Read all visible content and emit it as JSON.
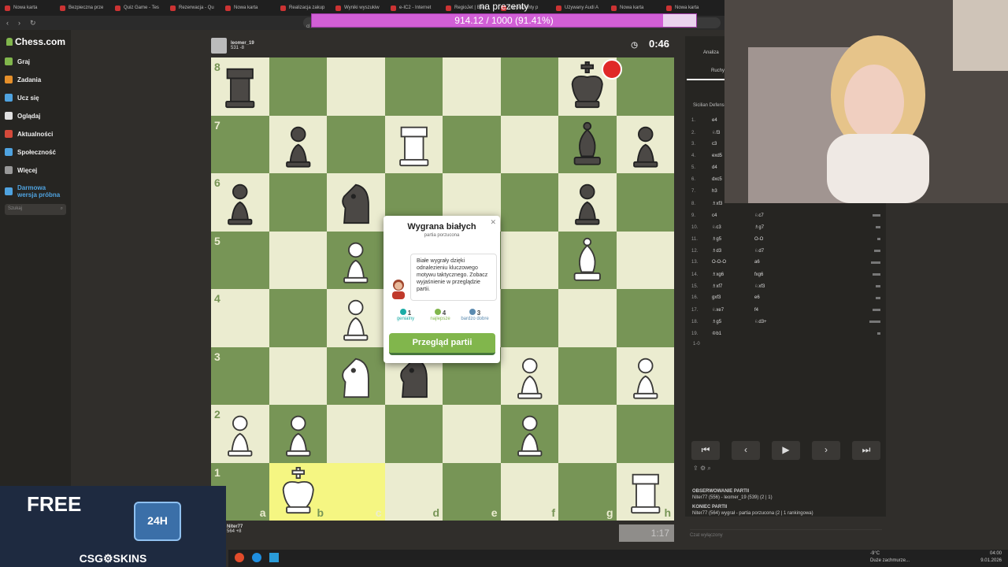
{
  "browser": {
    "tabs": [
      "Nowa karta",
      "Bezpieczna prze",
      "Quiz Game - Tes",
      "Rezerwacja - Qu",
      "Nowa karta",
      "Realizacja zakup",
      "Wyniki wyszukiw",
      "e-IC2 - Internet",
      "RegioJet | Bilet",
      "na prezenty p",
      "Używany Audi A",
      "Nowa karta",
      "Nowa karta"
    ],
    "address_stub": "cl"
  },
  "stream_overlay": {
    "title": "na prezenty",
    "progress_text": "914.12 / 1000 (91.41%)",
    "progress_fraction": 0.9141
  },
  "sidebar": {
    "logo": "Chess.com",
    "items": [
      {
        "label": "Graj",
        "color": "#81b64c"
      },
      {
        "label": "Zadania",
        "color": "#e58f2a"
      },
      {
        "label": "Ucz się",
        "color": "#4fa3e0"
      },
      {
        "label": "Oglądaj",
        "color": "#e0e0e0"
      },
      {
        "label": "Aktualności",
        "color": "#d4493a"
      },
      {
        "label": "Społeczność",
        "color": "#4fa3e0"
      },
      {
        "label": "Więcej",
        "color": "#999999"
      },
      {
        "label": "Darmowa wersja próbna",
        "color": "#4fa3e0"
      }
    ],
    "search_placeholder": "Szukaj"
  },
  "top_player": {
    "name": "leomer_19",
    "rating": "531 -8",
    "clock": "0:46"
  },
  "bottom_player": {
    "name": "Niter77",
    "rating": "564 +8",
    "clock": "1:17"
  },
  "board": {
    "ranks": [
      "8",
      "7",
      "6",
      "5",
      "4",
      "3",
      "2",
      "1"
    ],
    "files": [
      "a",
      "b",
      "c",
      "d",
      "e",
      "f",
      "g",
      "h"
    ],
    "pieces": [
      [
        "br",
        "",
        "",
        "",
        "",
        "",
        "bk",
        ""
      ],
      [
        "",
        "bp",
        "",
        "wr",
        "",
        "",
        "bb",
        "bp"
      ],
      [
        "bp",
        "",
        "bn",
        "",
        "",
        "",
        "bp",
        ""
      ],
      [
        "",
        "",
        "wp",
        "",
        "",
        "",
        "wb",
        ""
      ],
      [
        "",
        "",
        "wp",
        "",
        "",
        "",
        "",
        ""
      ],
      [
        "",
        "",
        "wn",
        "bn",
        "",
        "wp",
        "",
        "wp"
      ],
      [
        "wp",
        "wp",
        "",
        "",
        "",
        "wp",
        "",
        ""
      ],
      [
        "",
        "wk",
        "",
        "",
        "",
        "",
        "",
        "wr"
      ]
    ]
  },
  "modal": {
    "title": "Wygrana białych",
    "subtitle": "partia porzucona",
    "message": "Białe wygrały dzięki odnalezieniu kluczowego motywu taktycznego. Zobacz wyjaśnienie w przeglądzie partii.",
    "stats": [
      {
        "n": "1",
        "label": "genialny",
        "color": "#1baca6"
      },
      {
        "n": "4",
        "label": "najlepsze",
        "color": "#81b64c"
      },
      {
        "n": "3",
        "label": "bardzo dobre",
        "color": "#5c8bb0"
      }
    ],
    "button": "Przegląd partii"
  },
  "panel": {
    "tabs": [
      "Analiza",
      "Ruchy"
    ],
    "opening": "Sicilian Defense",
    "moves": [
      {
        "n": "1.",
        "w": "e4",
        "b": ""
      },
      {
        "n": "2.",
        "w": "♘f3",
        "b": ""
      },
      {
        "n": "3.",
        "w": "c3",
        "b": ""
      },
      {
        "n": "4.",
        "w": "exd5",
        "b": ""
      },
      {
        "n": "5.",
        "w": "d4",
        "b": ""
      },
      {
        "n": "6.",
        "w": "dxc5",
        "b": ""
      },
      {
        "n": "7.",
        "w": "h3",
        "b": ""
      },
      {
        "n": "8.",
        "w": "♗xf3",
        "b": ""
      },
      {
        "n": "9.",
        "w": "c4",
        "b": "♘c7"
      },
      {
        "n": "10.",
        "w": "♘c3",
        "b": "♗g7"
      },
      {
        "n": "11.",
        "w": "♗g5",
        "b": "O-O"
      },
      {
        "n": "12.",
        "w": "♗d3",
        "b": "♘d7"
      },
      {
        "n": "13.",
        "w": "O-O-O",
        "b": "a6"
      },
      {
        "n": "14.",
        "w": "♗xg6",
        "b": "fxg6"
      },
      {
        "n": "15.",
        "w": "♗xf7",
        "b": "♘xf3"
      },
      {
        "n": "16.",
        "w": "gxf3",
        "b": "e6"
      },
      {
        "n": "17.",
        "w": "♘xe7",
        "b": "f4"
      },
      {
        "n": "18.",
        "w": "♗g5",
        "b": "♘d3+"
      },
      {
        "n": "19.",
        "w": "♔b1",
        "b": ""
      }
    ],
    "result": "1-0",
    "nav": [
      "⏮",
      "‹",
      "▶",
      "›",
      "⏭"
    ],
    "observed_header": "OBSERWOWANIE PARTII",
    "observed_line": "Niter77 (556) - leomer_19 (539) (2 | 1)",
    "end_header": "KONIEC PARTII",
    "end_line": "Niter77 (564) wygrał - partia porzucona (2 | 1 rankingowa)",
    "chat": "Czat wyłączony"
  },
  "ad": {
    "title": "FREE",
    "brand": "CSG⚙SKINS",
    "badge": "24H"
  },
  "taskbar": {
    "weather": "-9°C",
    "weather_sub": "Duże zachmurze...",
    "time": "04:00",
    "date": "9.01.2026"
  }
}
